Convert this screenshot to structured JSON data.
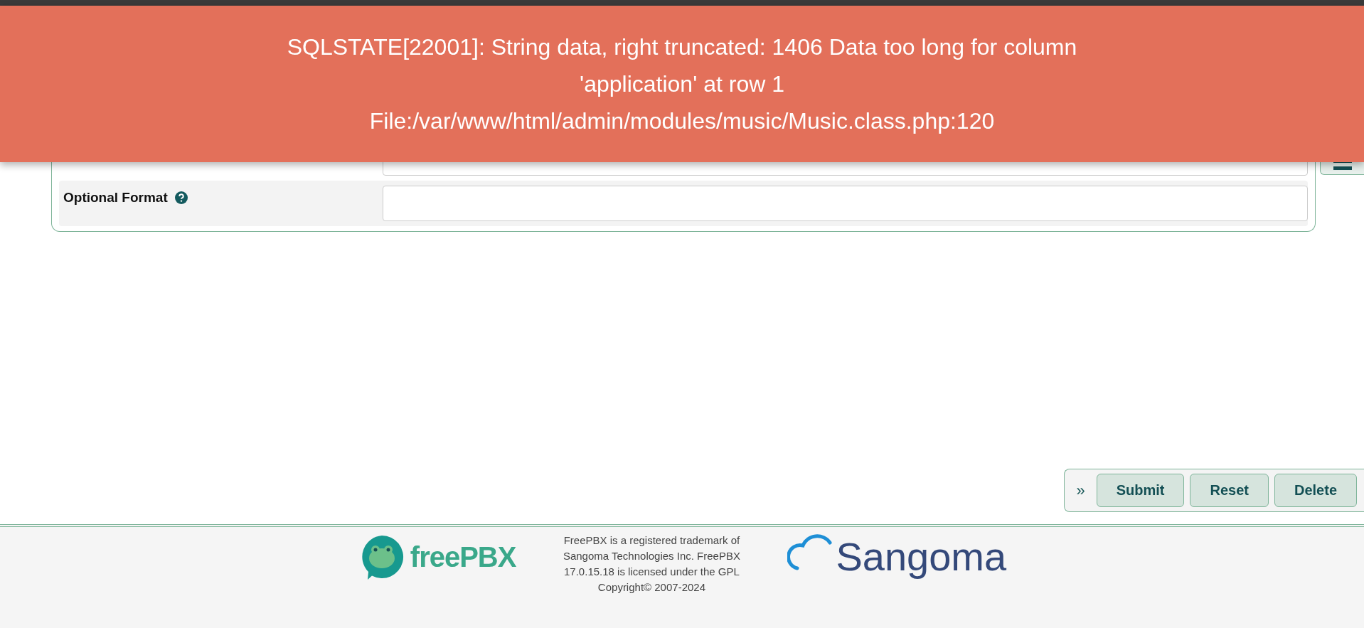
{
  "error_banner": {
    "lines": [
      "SQLSTATE[22001]: String data, right truncated: 1406 Data too long for column",
      "'application' at row 1",
      "File:/var/www/html/admin/modules/music/Music.class.php:120"
    ]
  },
  "form": {
    "rows": [
      {
        "label": "Optional Format",
        "help": true
      }
    ]
  },
  "actions": {
    "toggle": "»",
    "buttons": [
      "Submit",
      "Reset",
      "Delete"
    ]
  },
  "footer": {
    "freepbx_logo": "freePBX",
    "notice": "FreePBX is a registered trademark of Sangoma Technologies Inc. FreePBX 17.0.15.18 is licensed under the GPL",
    "copyright": "Copyright© 2007-2024",
    "sangoma_logo": "Sangoma"
  }
}
